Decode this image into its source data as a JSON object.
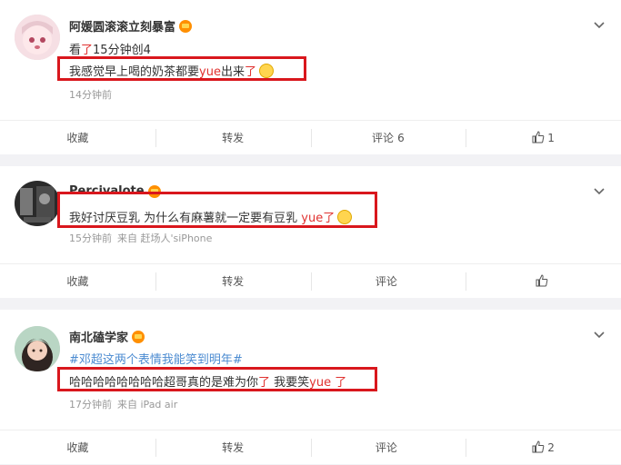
{
  "posts": [
    {
      "username": "阿媛圆滚滚立刻暴富",
      "subline_prefix": "看",
      "subline_red": "了",
      "subline_suffix": "15分钟创4",
      "comment_part1": "我感觉早上喝的奶茶都要",
      "comment_red1": "yue",
      "comment_part2": "出来",
      "comment_red2": "了",
      "time": "14分钟前",
      "actions": {
        "collect": "收藏",
        "repost": "转发",
        "comment": "评论",
        "comment_count": "6",
        "like_count": "1"
      }
    },
    {
      "username": "Percivalote",
      "comment_part1": "我好讨厌豆乳 为什么有麻薯就一定要有豆乳 ",
      "comment_red1": "yue",
      "comment_part2": "",
      "comment_red2": "了",
      "time": "15分钟前",
      "source": "来自 赶场人'siPhone",
      "actions": {
        "collect": "收藏",
        "repost": "转发",
        "comment": "评论",
        "comment_count": "",
        "like_count": ""
      }
    },
    {
      "username": "南北磕学家",
      "topic": "#邓超这两个表情我能笑到明年#",
      "comment_part1": "哈哈哈哈哈哈哈哈超哥真的是难为你",
      "comment_red1": "了",
      "comment_part2": " 我要笑",
      "comment_red2": "yue 了",
      "time": "17分钟前",
      "source": "来自 iPad air",
      "actions": {
        "collect": "收藏",
        "repost": "转发",
        "comment": "评论",
        "comment_count": "",
        "like_count": "2"
      }
    }
  ],
  "colors": {
    "highlight_box": "#d9171d",
    "red_text": "#e0312f",
    "topic": "#4b8bd1"
  }
}
